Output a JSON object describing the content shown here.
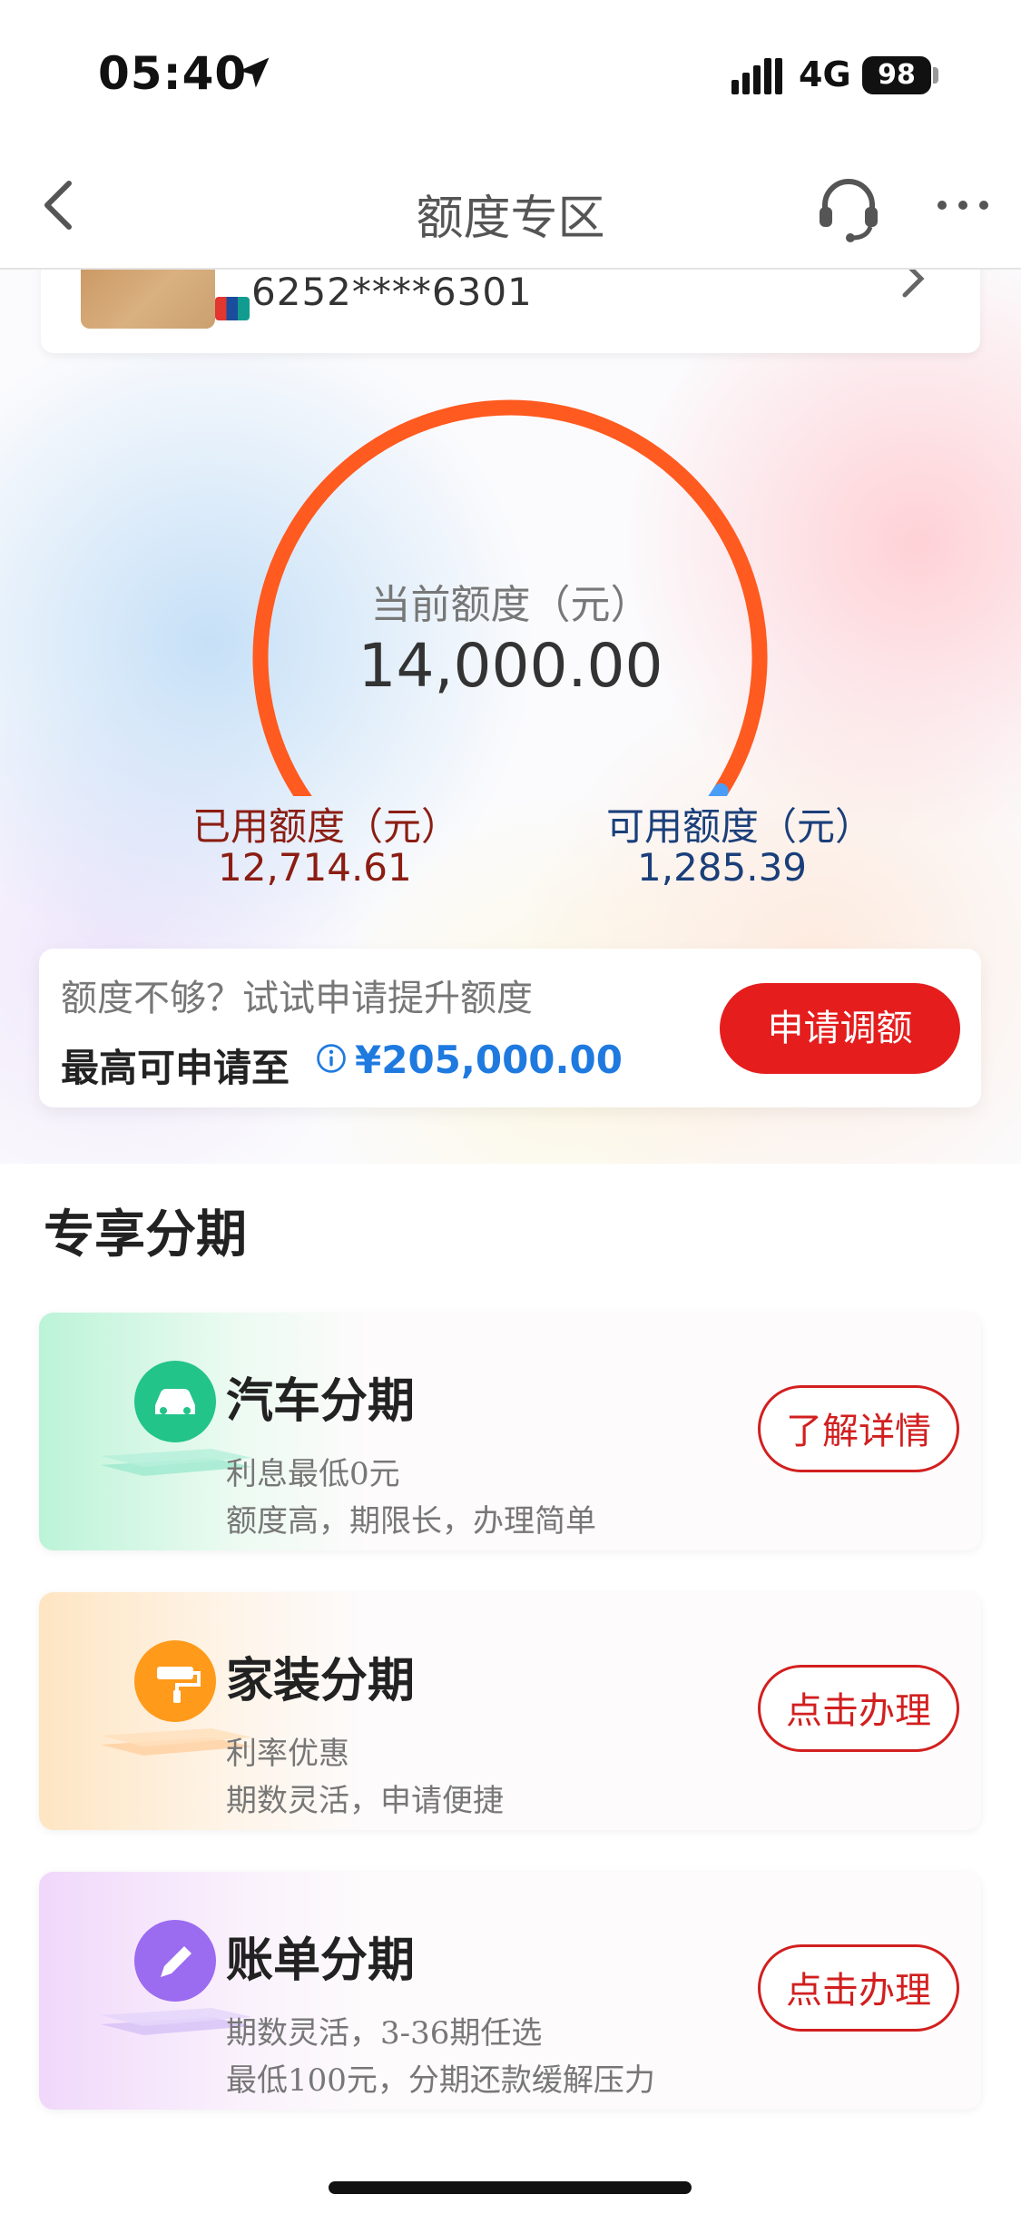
{
  "status_bar": {
    "time": "05:40",
    "network": "4G",
    "battery": "98"
  },
  "nav": {
    "title": "额度专区"
  },
  "card": {
    "number": "6252****6301"
  },
  "quota": {
    "label": "当前额度（元）",
    "total": "14,000.00",
    "used_label": "已用额度（元）",
    "used_value": "12,714.61",
    "available_label": "可用额度（元）",
    "available_value": "1,285.39",
    "used_fraction": 0.908,
    "colors": {
      "used": "#ff5a1f",
      "available": "#4a9df6"
    }
  },
  "raise": {
    "hint": "额度不够？试试申请提升额度",
    "max_label": "最高可申请至",
    "max_value": "¥205,000.00",
    "button": "申请调额"
  },
  "installments": {
    "title": "专享分期",
    "items": [
      {
        "title": "汽车分期",
        "desc1": "利息最低0元",
        "desc2": "额度高，期限长，办理简单",
        "button": "了解详情",
        "icon": "car-icon",
        "color": "#2ecf8a"
      },
      {
        "title": "家装分期",
        "desc1": "利率优惠",
        "desc2": "期数灵活，申请便捷",
        "button": "点击办理",
        "icon": "paint-roller-icon",
        "color": "#ff9a1a"
      },
      {
        "title": "账单分期",
        "desc1": "期数灵活，3-36期任选",
        "desc2": "最低100元，分期还款缓解压力",
        "button": "点击办理",
        "icon": "pencil-icon",
        "color": "#9b6bf0"
      }
    ]
  }
}
